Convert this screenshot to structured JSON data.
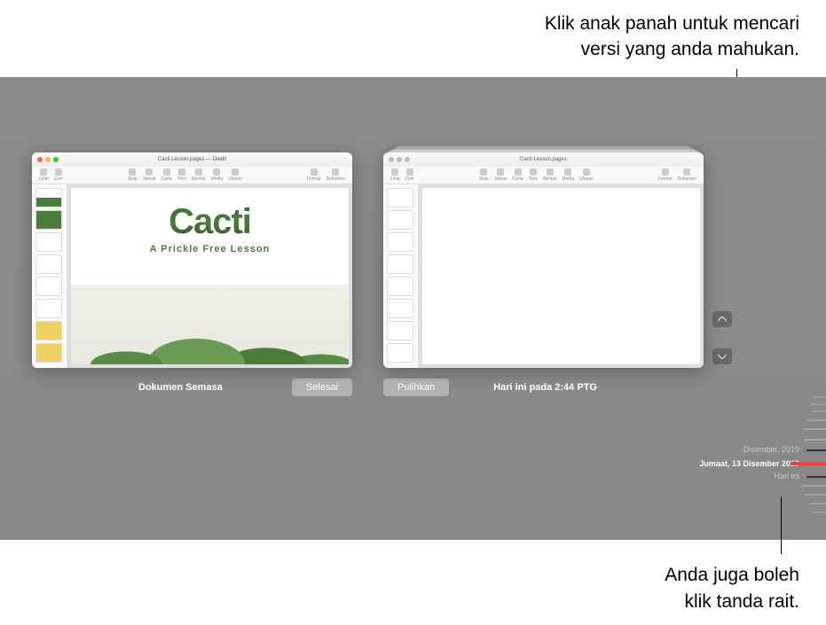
{
  "callouts": {
    "top_line1": "Klik anak panah untuk mencari",
    "top_line2": "versi yang anda mahukan.",
    "bottom_line1": "Anda juga boleh",
    "bottom_line2": "klik tanda rait."
  },
  "current_window": {
    "title": "Cacti Lesson.pages — Diedit",
    "label": "Dokumen Semasa",
    "done_button": "Selesai",
    "page": {
      "title": "Cacti",
      "subtitle": "A Prickle Free Lesson"
    },
    "toolbar": {
      "left": [
        "Lihat",
        "Zum"
      ],
      "center": [
        "Sisip",
        "Jadual",
        "Carta",
        "Teks",
        "Bentuk",
        "Media",
        "Ulasan"
      ],
      "right": [
        "Format",
        "Dokumen"
      ]
    }
  },
  "version_window": {
    "title": "Cacti Lesson.pages",
    "restore_button": "Pulihkan",
    "timestamp": "Hari ini pada  2:44 PTG",
    "toolbar": {
      "left": [
        "Lihat",
        "Zum"
      ],
      "center": [
        "Sisip",
        "Jadual",
        "Carta",
        "Teks",
        "Bentuk",
        "Media",
        "Ulasan"
      ],
      "right": [
        "Format",
        "Dokumen"
      ]
    }
  },
  "timeline": {
    "month_label": "Disember, 2019",
    "selected_label": "Jumaat, 13 Disember 2019",
    "today_label": "Hari Ini"
  }
}
